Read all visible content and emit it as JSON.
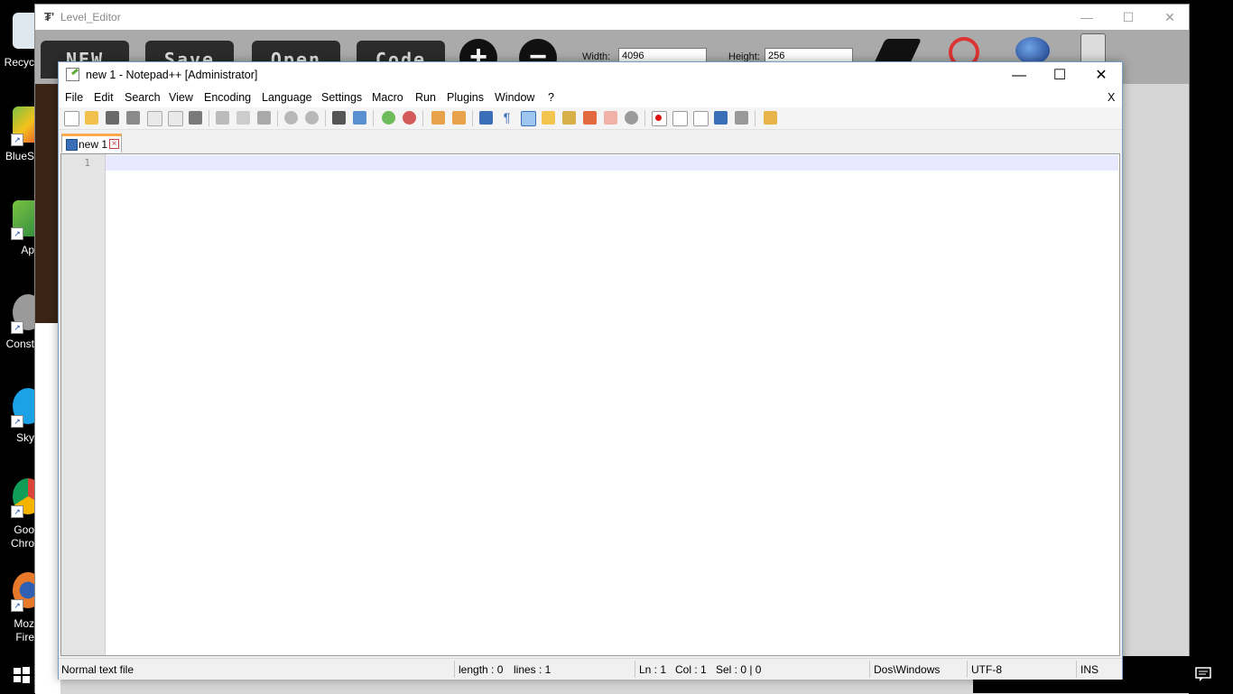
{
  "desktop": {
    "icons": [
      {
        "label": "Recyc",
        "name": "recycle-bin"
      },
      {
        "label": "BlueS",
        "name": "bluestacks"
      },
      {
        "label": "Ap",
        "name": "apps"
      },
      {
        "label": "Const",
        "name": "construct"
      },
      {
        "label": "Sky",
        "name": "skype"
      },
      {
        "label": "Goo\nChro",
        "name": "google-chrome"
      },
      {
        "label": "Moz\nFire",
        "name": "mozilla-firefox"
      }
    ]
  },
  "level_editor": {
    "title": "Level_Editor",
    "buttons": {
      "new": "NEW",
      "save": "Save",
      "open": "Open",
      "code": "Code",
      "plus": "+",
      "minus": "−"
    },
    "width_label": "Width:",
    "width_value": "4096",
    "height_label": "Height:",
    "height_value": "256",
    "controls": {
      "minimize": "—",
      "maximize": "☐",
      "close": "✕"
    }
  },
  "notepad": {
    "title": "new 1 - Notepad++ [Administrator]",
    "controls": {
      "minimize": "—",
      "maximize": "☐",
      "close": "✕"
    },
    "menu": [
      "File",
      "Edit",
      "Search",
      "View",
      "Encoding",
      "Language",
      "Settings",
      "Macro",
      "Run",
      "Plugins",
      "Window",
      "?"
    ],
    "close_doc": "X",
    "tab": {
      "label": "new 1",
      "close": "×"
    },
    "line_number": "1",
    "status": {
      "file_type": "Normal text file",
      "length": "length : 0",
      "lines": "lines : 1",
      "ln": "Ln : 1",
      "col": "Col : 1",
      "sel": "Sel : 0 | 0",
      "eol": "Dos\\Windows",
      "encoding": "UTF-8",
      "mode": "INS"
    }
  }
}
